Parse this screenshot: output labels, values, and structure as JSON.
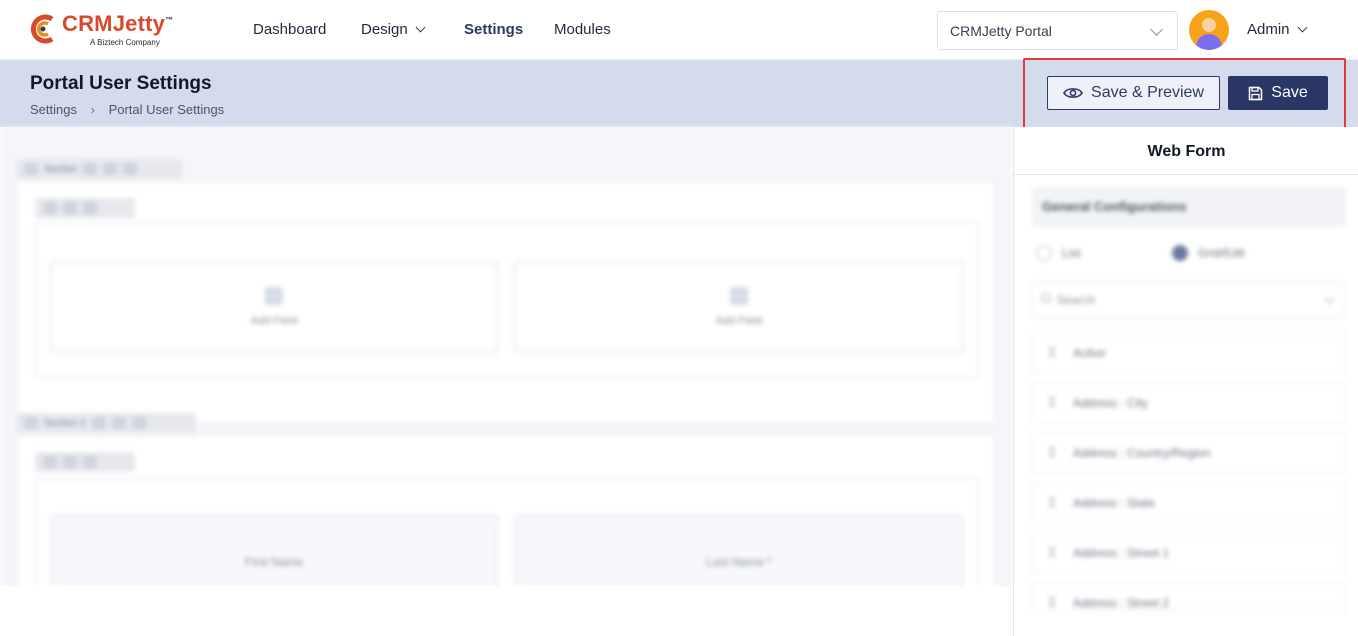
{
  "brand": {
    "name": "CRMJetty",
    "trademark": "™",
    "tagline": "A Biztech Company",
    "color": "#d94a2b"
  },
  "nav": {
    "items": [
      {
        "label": "Dashboard",
        "has_dropdown": false,
        "active": false
      },
      {
        "label": "Design",
        "has_dropdown": true,
        "active": false
      },
      {
        "label": "Settings",
        "has_dropdown": false,
        "active": true
      },
      {
        "label": "Modules",
        "has_dropdown": false,
        "active": false
      }
    ],
    "portal_select": {
      "value": "CRMJetty Portal"
    },
    "user": {
      "name": "Admin"
    }
  },
  "header": {
    "title": "Portal User Settings",
    "breadcrumb": [
      "Settings",
      "Portal User Settings"
    ],
    "buttons": {
      "preview": "Save & Preview",
      "save": "Save"
    },
    "accent": "#2a3764",
    "highlight_color": "#e03a3a"
  },
  "canvas": {
    "section1": {
      "label": "Section"
    },
    "section1_fields": [
      "Add Field",
      "Add Field"
    ],
    "section2": {
      "label": "Section 2"
    },
    "section2_fields": [
      "First Name",
      "Last Name *"
    ]
  },
  "panel": {
    "title": "Web Form",
    "config_header": "General Configurations",
    "radio": [
      {
        "label": "List",
        "selected": false
      },
      {
        "label": "Grid/Edit",
        "selected": true
      }
    ],
    "search_placeholder": "Search",
    "fields": [
      "Active",
      "Address : City",
      "Address : Country/Region",
      "Address : State",
      "Address : Street 1",
      "Address : Street 2"
    ]
  }
}
